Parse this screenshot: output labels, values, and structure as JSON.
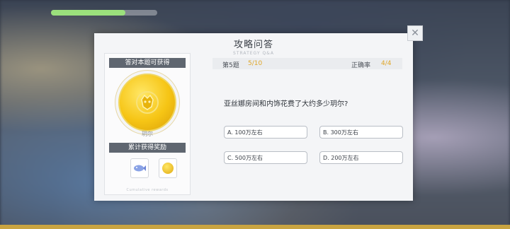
{
  "dialog": {
    "title": "攻略问答",
    "subtitle": "STRATEGY Q&A",
    "close_icon": "close-x-icon"
  },
  "rewards_panel": {
    "header": "答对本题可获得",
    "coin_caption": "玥尔",
    "cumulative_header": "累计获得奖励",
    "footer": "Cumulative rewards",
    "items": [
      {
        "icon": "blue-fish-item-icon"
      },
      {
        "icon": "gold-coin-icon"
      }
    ]
  },
  "quiz": {
    "question_label": "第5题",
    "progress": "5/10",
    "accuracy_label": "正确率",
    "accuracy_value": "4/4",
    "question": "亚丝娜房间和内饰花费了大约多少玥尔?",
    "options": [
      "A. 100万左右",
      "B. 300万左右",
      "C. 500万左右",
      "D. 200万左右"
    ]
  },
  "colors": {
    "accent": "#e0a72a",
    "header_tag": "#5f6670",
    "coin_gold": "#f6c515"
  }
}
